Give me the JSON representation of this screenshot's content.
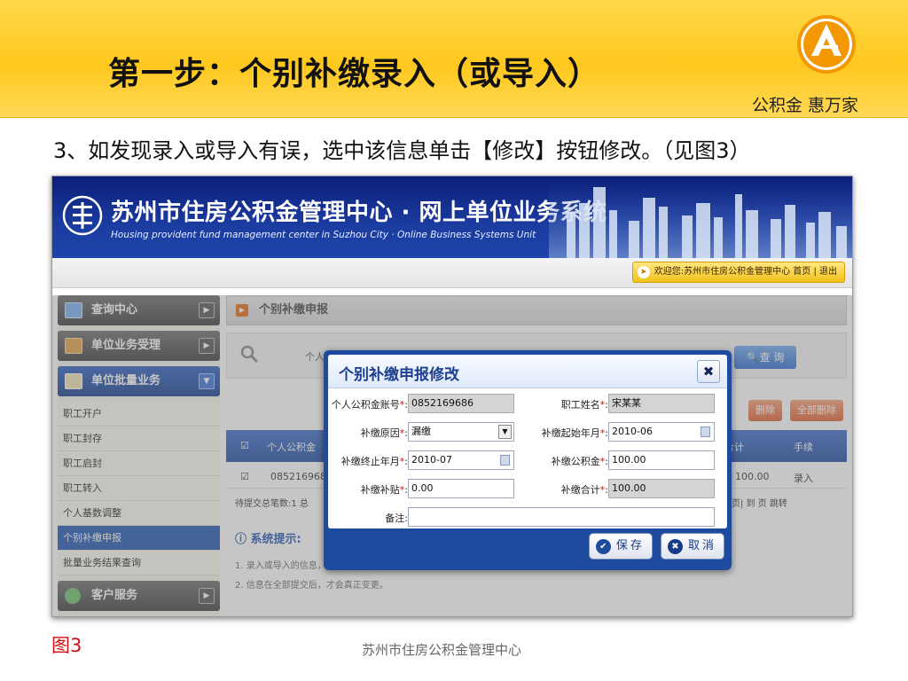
{
  "slide": {
    "title": "第一步：个别补缴录入（或导入）",
    "slogan": "公积金  惠万家",
    "instruction": "3、如发现录入或导入有误，选中该信息单击【修改】按钮修改。（见图3）",
    "figure_label": "图3",
    "footer": "苏州市住房公积金管理中心"
  },
  "app": {
    "title_cn": "苏州市住房公积金管理中心 · 网上单位业务系统",
    "title_en": "Housing provident fund management center in Suzhou City · Online Business Systems Unit",
    "welcome": "欢迎您:苏州市住房公积金管理中心 首页 | 退出"
  },
  "sidebar": {
    "sections": [
      {
        "label": "查询中心",
        "icon": "monitor-icon"
      },
      {
        "label": "单位业务受理",
        "icon": "briefcase-icon"
      },
      {
        "label": "单位批量业务",
        "icon": "documents-icon"
      }
    ],
    "items": [
      "职工开户",
      "职工封存",
      "职工启封",
      "职工转入",
      "个人基数调整",
      "个别补缴申报",
      "批量业务结果查询"
    ],
    "selected_index": 5,
    "bottom_section": {
      "label": "客户服务",
      "icon": "person-icon"
    }
  },
  "main": {
    "title": "个别补缴申报",
    "search_label": "个人",
    "query_button": "查 询",
    "delete_button": "删除",
    "delete_all_button": "全部删除",
    "grid_headers": [
      "个人公积金",
      "合计",
      "手续"
    ],
    "grid_row": {
      "account": "085216968",
      "amount": "100.00",
      "status": "录入"
    },
    "pager_left": "待提交总笔数:1  总",
    "pager_right": "末页| 到      页 跳转",
    "tip_title": "系统提示:",
    "tips": [
      "1. 录入或导入的信息，可以修改。全部提交的信息，不能再修改。",
      "2. 信息在全部提交后，才会真正变更。"
    ]
  },
  "modal": {
    "title": "个别补缴申报修改",
    "fields": {
      "account": {
        "label": "个人公积金账号",
        "value": "0852169686"
      },
      "name": {
        "label": "职工姓名",
        "value": "宋某某"
      },
      "reason": {
        "label": "补缴原因",
        "value": "漏缴"
      },
      "start_month": {
        "label": "补缴起始年月",
        "value": "2010-06"
      },
      "end_month": {
        "label": "补缴终止年月",
        "value": "2010-07"
      },
      "fund": {
        "label": "补缴公积金",
        "value": "100.00"
      },
      "subsidy": {
        "label": "补缴补贴",
        "value": "0.00"
      },
      "total": {
        "label": "补缴合计",
        "value": "100.00"
      },
      "remark": {
        "label": "备注",
        "value": ""
      }
    },
    "save_label": "保存",
    "cancel_label": "取消"
  },
  "colors": {
    "header_yellow": "#ffc81e",
    "banner_blue": "#1b3ca0",
    "modal_blue": "#1e4b9e",
    "required_red": "#e00000",
    "figure_red": "#d01010"
  }
}
